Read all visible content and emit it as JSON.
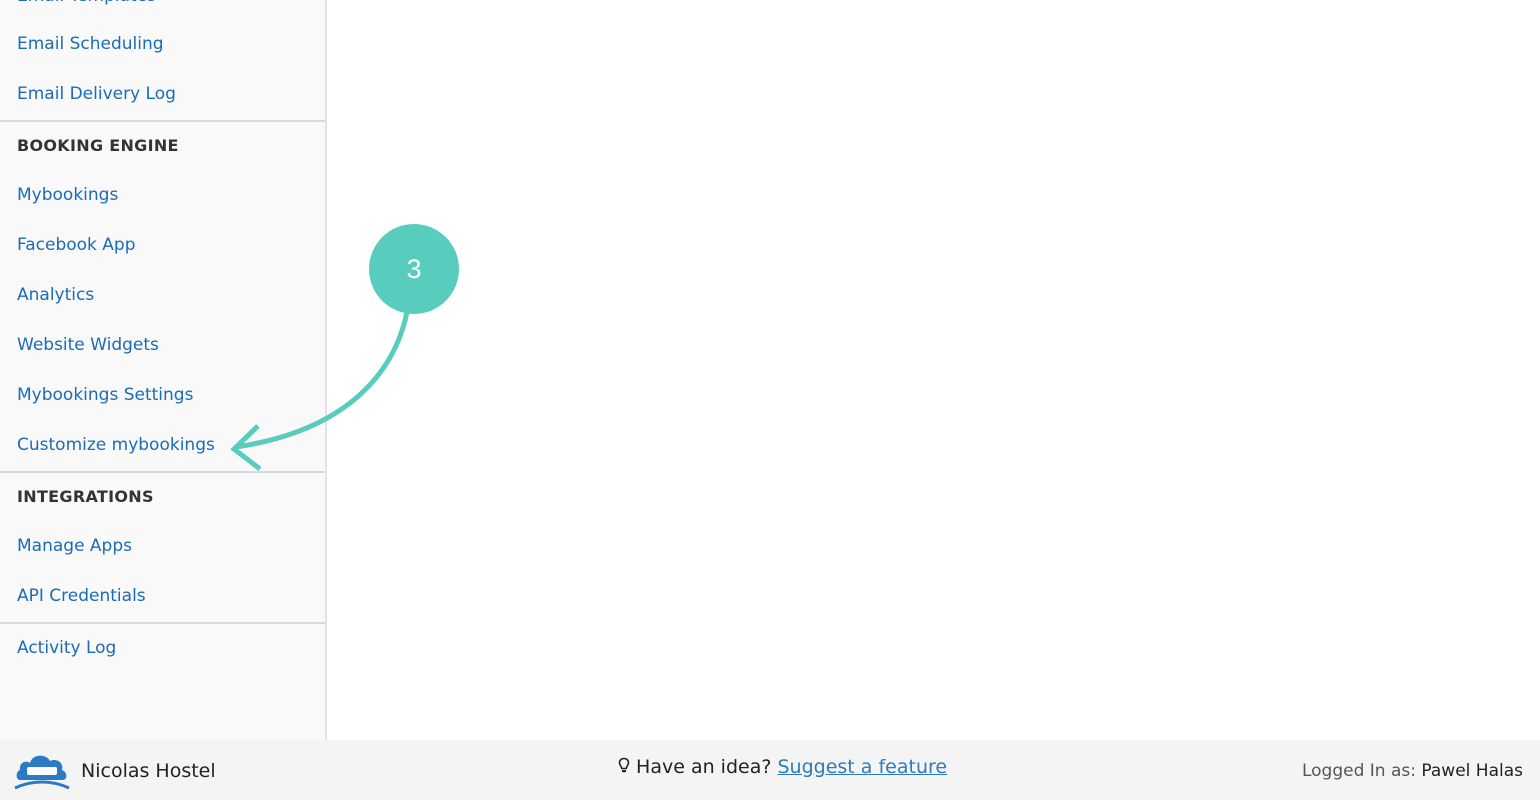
{
  "sidebar": {
    "items_top": [
      "Email Templates",
      "Email Scheduling",
      "Email Delivery Log"
    ],
    "booking_engine": {
      "heading": "BOOKING ENGINE",
      "items": [
        "Mybookings",
        "Facebook App",
        "Analytics",
        "Website Widgets",
        "Mybookings Settings",
        "Customize mybookings"
      ]
    },
    "integrations": {
      "heading": "INTEGRATIONS",
      "items": [
        "Manage Apps",
        "API Credentials"
      ]
    },
    "bottom": [
      "Activity Log"
    ]
  },
  "annotation": {
    "step_number": "3",
    "color": "#58cdbd",
    "points_to": "Customize mybookings"
  },
  "footer": {
    "property_name": "Nicolas Hostel",
    "idea_text": "Have an idea?",
    "suggest_link": "Suggest a feature",
    "logged_in_label": "Logged In as:",
    "user_name": "Pawel Halas"
  },
  "colors": {
    "link": "#1a6bb8",
    "accent": "#58cdbd"
  }
}
